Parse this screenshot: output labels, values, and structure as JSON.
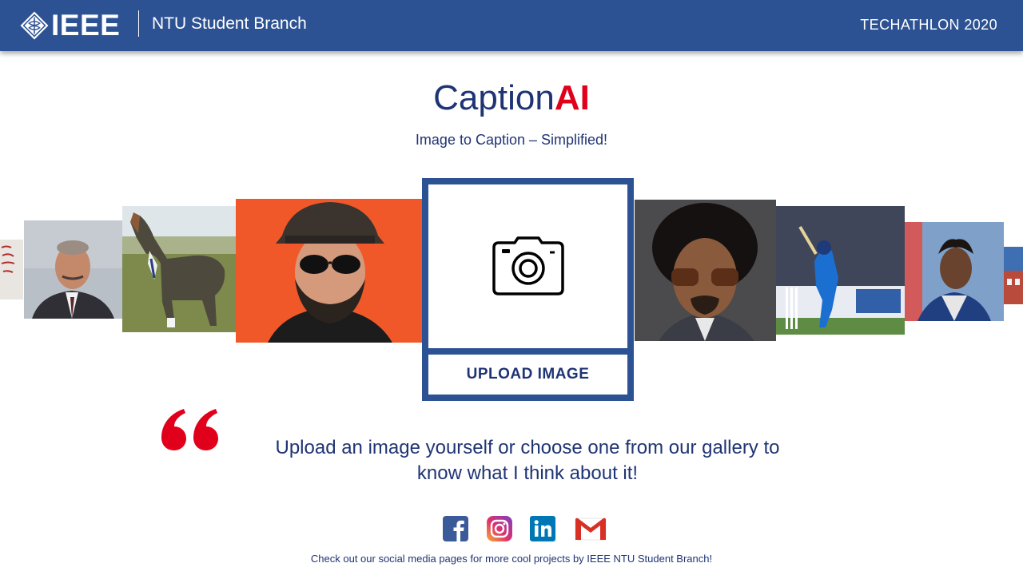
{
  "header": {
    "logo_text": "IEEE",
    "branch": "NTU Student Branch",
    "event": "TECHATHLON 2020",
    "color": "#2d5293"
  },
  "title": {
    "part1": "Caption",
    "part2": "AI",
    "accent": "#e0001b"
  },
  "subtitle": "Image to Caption – Simplified!",
  "gallery": [
    {
      "name": "graffiti-wall-photo"
    },
    {
      "name": "man-in-suit-portrait"
    },
    {
      "name": "horse-in-suit-photo"
    },
    {
      "name": "bearded-man-sunglasses-photo"
    },
    {
      "name": "man-with-afro-sunglasses-photo"
    },
    {
      "name": "cricket-batsman-photo"
    },
    {
      "name": "man-in-jacket-portrait"
    },
    {
      "name": "building-photo"
    }
  ],
  "upload": {
    "icon": "camera-icon",
    "button_label": "UPLOAD IMAGE"
  },
  "quote": {
    "line1": "Upload an image yourself or choose one from our gallery to",
    "line2": "know what I think about it!"
  },
  "social": [
    "facebook-icon",
    "instagram-icon",
    "linkedin-icon",
    "gmail-icon"
  ],
  "footer": "Check out our social media pages for more cool projects by IEEE NTU Student Branch!"
}
